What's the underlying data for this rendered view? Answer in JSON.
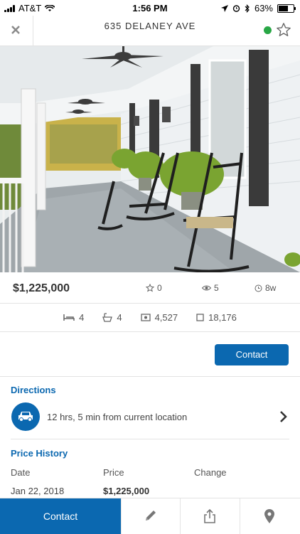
{
  "status_bar": {
    "carrier": "AT&T",
    "time": "1:56 PM",
    "battery": "63%"
  },
  "header": {
    "title": "635 DELANEY AVE"
  },
  "listing": {
    "price": "$1,225,000",
    "favorites": "0",
    "views": "5",
    "age": "8w"
  },
  "features": {
    "beds": "4",
    "baths": "4",
    "sqft": "4,527",
    "lot": "18,176"
  },
  "actions": {
    "contact_label": "Contact"
  },
  "directions": {
    "title": "Directions",
    "text": "12 hrs, 5 min from current location"
  },
  "price_history": {
    "title": "Price History",
    "columns": [
      "Date",
      "Price",
      "Change"
    ],
    "rows": [
      {
        "date": "Jan 22, 2018",
        "price": "$1,225,000",
        "change": ""
      }
    ]
  },
  "bottom_bar": {
    "contact_label": "Contact"
  },
  "colors": {
    "accent": "#0b68b0",
    "status_dot": "#28a745"
  }
}
